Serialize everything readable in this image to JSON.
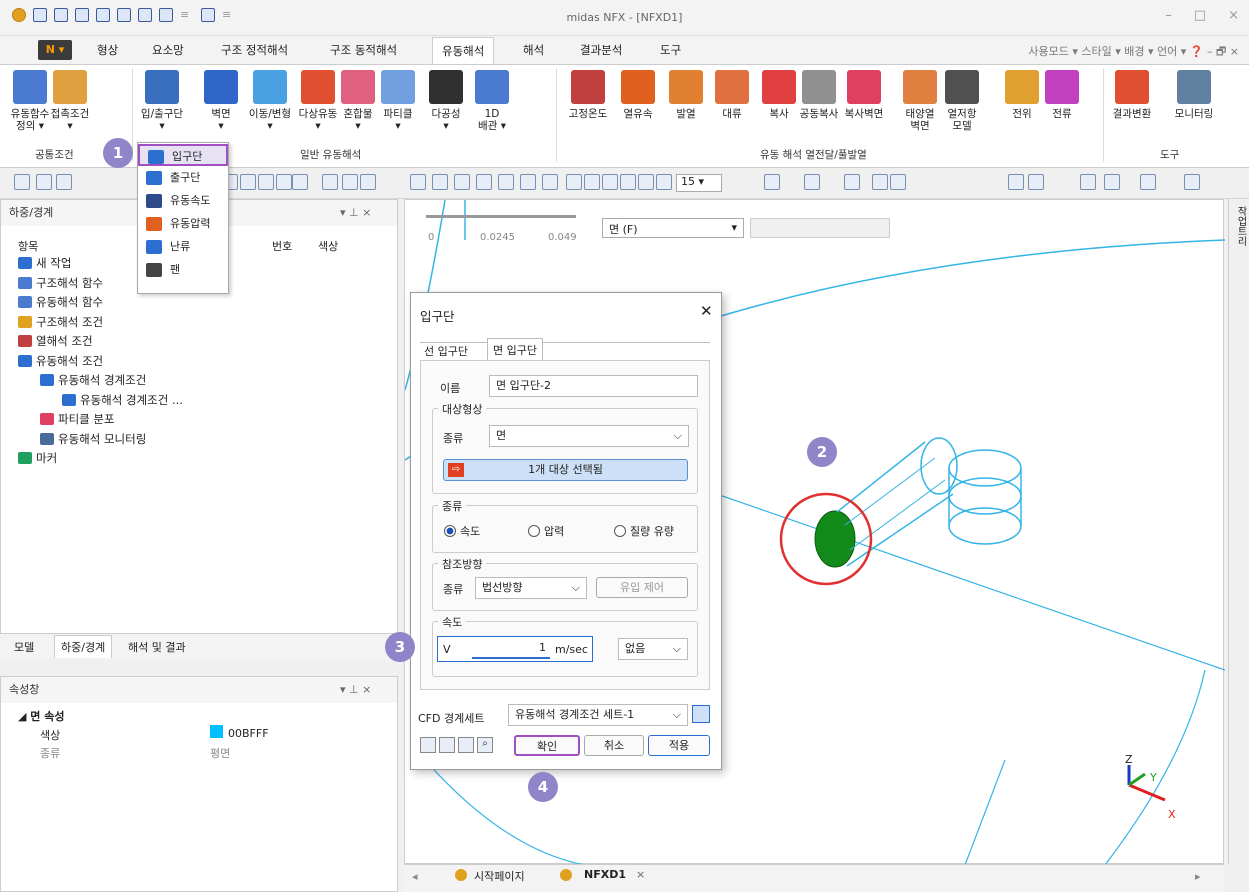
{
  "window": {
    "title": "midas NFX - [NFXD1]",
    "minimize": "–",
    "maximize": "□",
    "close": "×"
  },
  "menu": {
    "tabs": [
      "형상",
      "요소망",
      "구조 정적해석",
      "구조 동적해석",
      "유동해석",
      "해석",
      "결과분석",
      "도구"
    ],
    "active_tab": "유동해석",
    "right": "사용모드 ▾ 스타일 ▾ 배경 ▾ 언어 ▾ ❓ – 🗗 ×"
  },
  "ribbon": {
    "buttons": [
      {
        "label": "유동함수\n정의 ▾",
        "color": "#4a7bd0"
      },
      {
        "label": "접촉조건\n▾",
        "color": "#e0a040"
      },
      {
        "label": "입/출구단\n▾",
        "color": "#3a6fc0"
      },
      {
        "label": "벽면\n▾",
        "color": "#2f66c8"
      },
      {
        "label": "이동/변형\n▾",
        "color": "#4aa0e0"
      },
      {
        "label": "다상유동\n▾",
        "color": "#e05030"
      },
      {
        "label": "혼합물\n▾",
        "color": "#e06080"
      },
      {
        "label": "파티클\n▾",
        "color": "#70a0e0"
      },
      {
        "label": "다공성\n▾",
        "color": "#303030"
      },
      {
        "label": "1D\n배관 ▾",
        "color": "#4a7bd0"
      },
      {
        "label": "고정온도",
        "color": "#c04040"
      },
      {
        "label": "열유속",
        "color": "#e06020"
      },
      {
        "label": "발열",
        "color": "#e08030"
      },
      {
        "label": "대류",
        "color": "#e07040"
      },
      {
        "label": "복사",
        "color": "#e04040"
      },
      {
        "label": "공동복사",
        "color": "#909090"
      },
      {
        "label": "복사벽면",
        "color": "#e04060"
      },
      {
        "label": "태양열\n벽면",
        "color": "#e08040"
      },
      {
        "label": "열저항\n모델",
        "color": "#505050"
      },
      {
        "label": "전위",
        "color": "#e0a030"
      },
      {
        "label": "전류",
        "color": "#c040c0"
      },
      {
        "label": "결과변환",
        "color": "#e05030"
      },
      {
        "label": "모니터링",
        "color": "#6080a0"
      }
    ],
    "groups": {
      "common": "공통조건",
      "general": "일반 유동해석",
      "heat": "유동 해석 열전달/풀발열",
      "tools": "도구"
    }
  },
  "dropdown": {
    "items": [
      "입구단",
      "출구단",
      "유동속도",
      "유동압력",
      "난류",
      "팬"
    ]
  },
  "load_panel": {
    "title": "하중/경계",
    "col_item": "항목",
    "col_no": "번호",
    "col_color": "색상",
    "tree": [
      {
        "label": "새 작업",
        "level": 0
      },
      {
        "label": "구조해석 함수",
        "level": 0
      },
      {
        "label": "유동해석 함수",
        "level": 0
      },
      {
        "label": "구조해석 조건",
        "level": 0
      },
      {
        "label": "열해석 조건",
        "level": 0
      },
      {
        "label": "유동해석 조건",
        "level": 0
      },
      {
        "label": "유동해석 경계조건",
        "level": 1
      },
      {
        "label": "유동해석 경계조건 ...",
        "level": 2
      },
      {
        "label": "파티클 분포",
        "level": 1
      },
      {
        "label": "유동해석 모니터링",
        "level": 1
      },
      {
        "label": "마커",
        "level": 0
      }
    ],
    "tabs": [
      "모델",
      "하중/경계",
      "해석 및 결과"
    ]
  },
  "props_panel": {
    "title": "속성창",
    "section": "면 속성",
    "rows": [
      {
        "key": "색상",
        "value": "00BFFF",
        "swatch": "#00BFFF"
      },
      {
        "key": "종류",
        "value": "평면"
      }
    ]
  },
  "viewport_bar": {
    "scale_0": "0",
    "scale_1": "0.0245",
    "scale_2": "0.049",
    "select_mode": "면 (F)",
    "side_label": "작업트리"
  },
  "dialog": {
    "title": "입구단",
    "tabs": [
      "선 입구단",
      "면 입구단"
    ],
    "name_label": "이름",
    "name_value": "면 입구단-2",
    "target_shape": "대상형상",
    "type_label": "종류",
    "type_value": "면",
    "selected": "1개 대상 선택됨",
    "kind_legend": "종류",
    "kind_options": [
      "속도",
      "압력",
      "질량 유량"
    ],
    "ref_legend": "참조방향",
    "ref_label": "종류",
    "ref_value": "법선방향",
    "inflow_ctrl": "유입 제어",
    "speed_legend": "속도",
    "v_label": "V",
    "v_value": "1",
    "v_unit": "m/sec",
    "func_value": "없음",
    "cfd_label": "CFD 경계세트",
    "cfd_value": "유동해석 경계조건 세트-1",
    "ok": "확인",
    "cancel": "취소",
    "apply": "적용"
  },
  "callouts": [
    "1",
    "2",
    "3",
    "4"
  ],
  "bottom_tabs": {
    "start": "시작페이지",
    "doc": "NFXD1"
  },
  "axes": {
    "x": "X",
    "y": "Y",
    "z": "Z"
  }
}
